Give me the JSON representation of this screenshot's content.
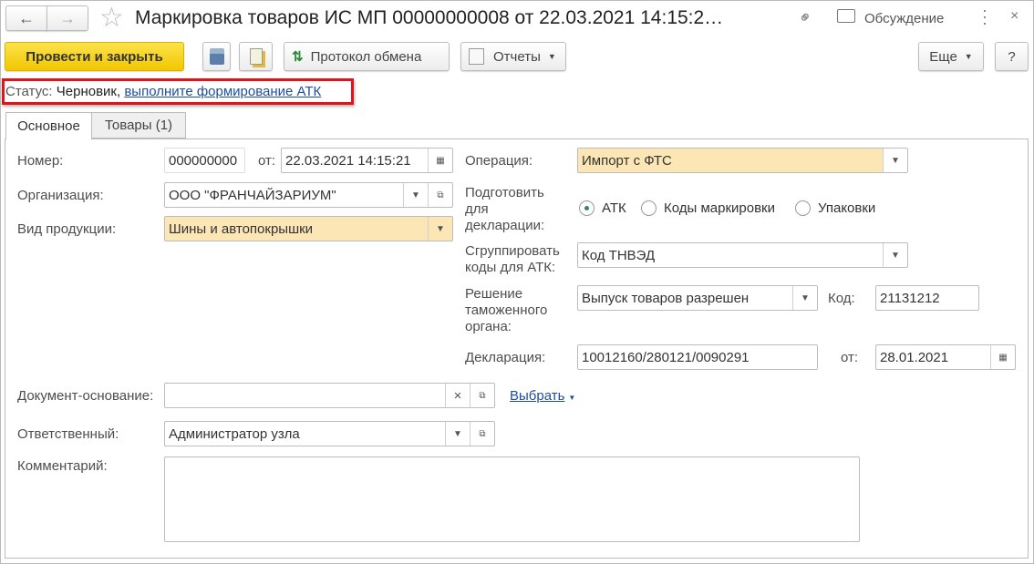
{
  "window": {
    "title": "Маркировка товаров ИС МП 00000000008 от 22.03.2021 14:15:2…",
    "discussion": "Обсуждение"
  },
  "toolbar": {
    "post_close": "Провести и закрыть",
    "exchange_log": "Протокол обмена",
    "reports": "Отчеты",
    "more": "Еще",
    "help": "?"
  },
  "status": {
    "label": "Статус:",
    "value": "Черновик,",
    "link": "выполните формирование АТК"
  },
  "tabs": [
    {
      "label": "Основное"
    },
    {
      "label": "Товары (1)"
    }
  ],
  "form": {
    "number_label": "Номер:",
    "number": "000000000",
    "from_label": "от:",
    "date": "22.03.2021 14:15:21",
    "org_label": "Организация:",
    "org": "ООО \"ФРАНЧАЙЗАРИУМ\"",
    "product_label": "Вид продукции:",
    "product": "Шины и автопокрышки",
    "operation_label": "Операция:",
    "operation": "Импорт с ФТС",
    "prepare_label": "Подготовить для декларации:",
    "prepare_options": [
      "АТК",
      "Коды маркировки",
      "Упаковки"
    ],
    "prepare_selected": "АТК",
    "group_label": "Сгруппировать коды для АТК:",
    "group": "Код ТНВЭД",
    "decision_label": "Решение таможенного органа:",
    "decision": "Выпуск товаров разрешен",
    "code_label": "Код:",
    "code": "21131212",
    "declaration_label": "Декларация:",
    "declaration": "10012160/280121/0090291",
    "decl_from_label": "от:",
    "decl_date": "28.01.2021",
    "basis_label": "Документ-основание:",
    "basis": "",
    "select_link": "Выбрать",
    "responsible_label": "Ответственный:",
    "responsible": "Администратор узла",
    "comment_label": "Комментарий:",
    "comment": ""
  }
}
